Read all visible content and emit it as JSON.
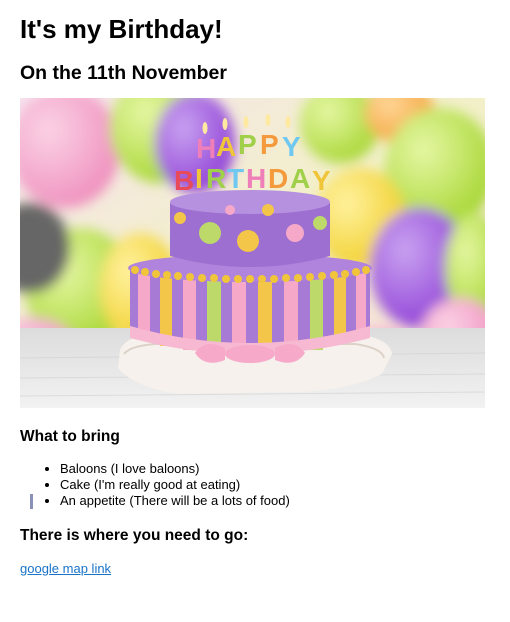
{
  "page": {
    "title": "It's my Birthday!",
    "subtitle": "On the 11th November",
    "image_alt": "Birthday cake",
    "bring_heading": "What to bring",
    "bring_items": [
      "Baloons (I love baloons)",
      "Cake (I'm really good at eating)",
      "An appetite (There will be a lots of food)"
    ],
    "go_heading": "There is where you need to go:",
    "map_link": "google map link"
  },
  "colors": {
    "link": "#1a73c8",
    "caret": "#8a91b8"
  }
}
